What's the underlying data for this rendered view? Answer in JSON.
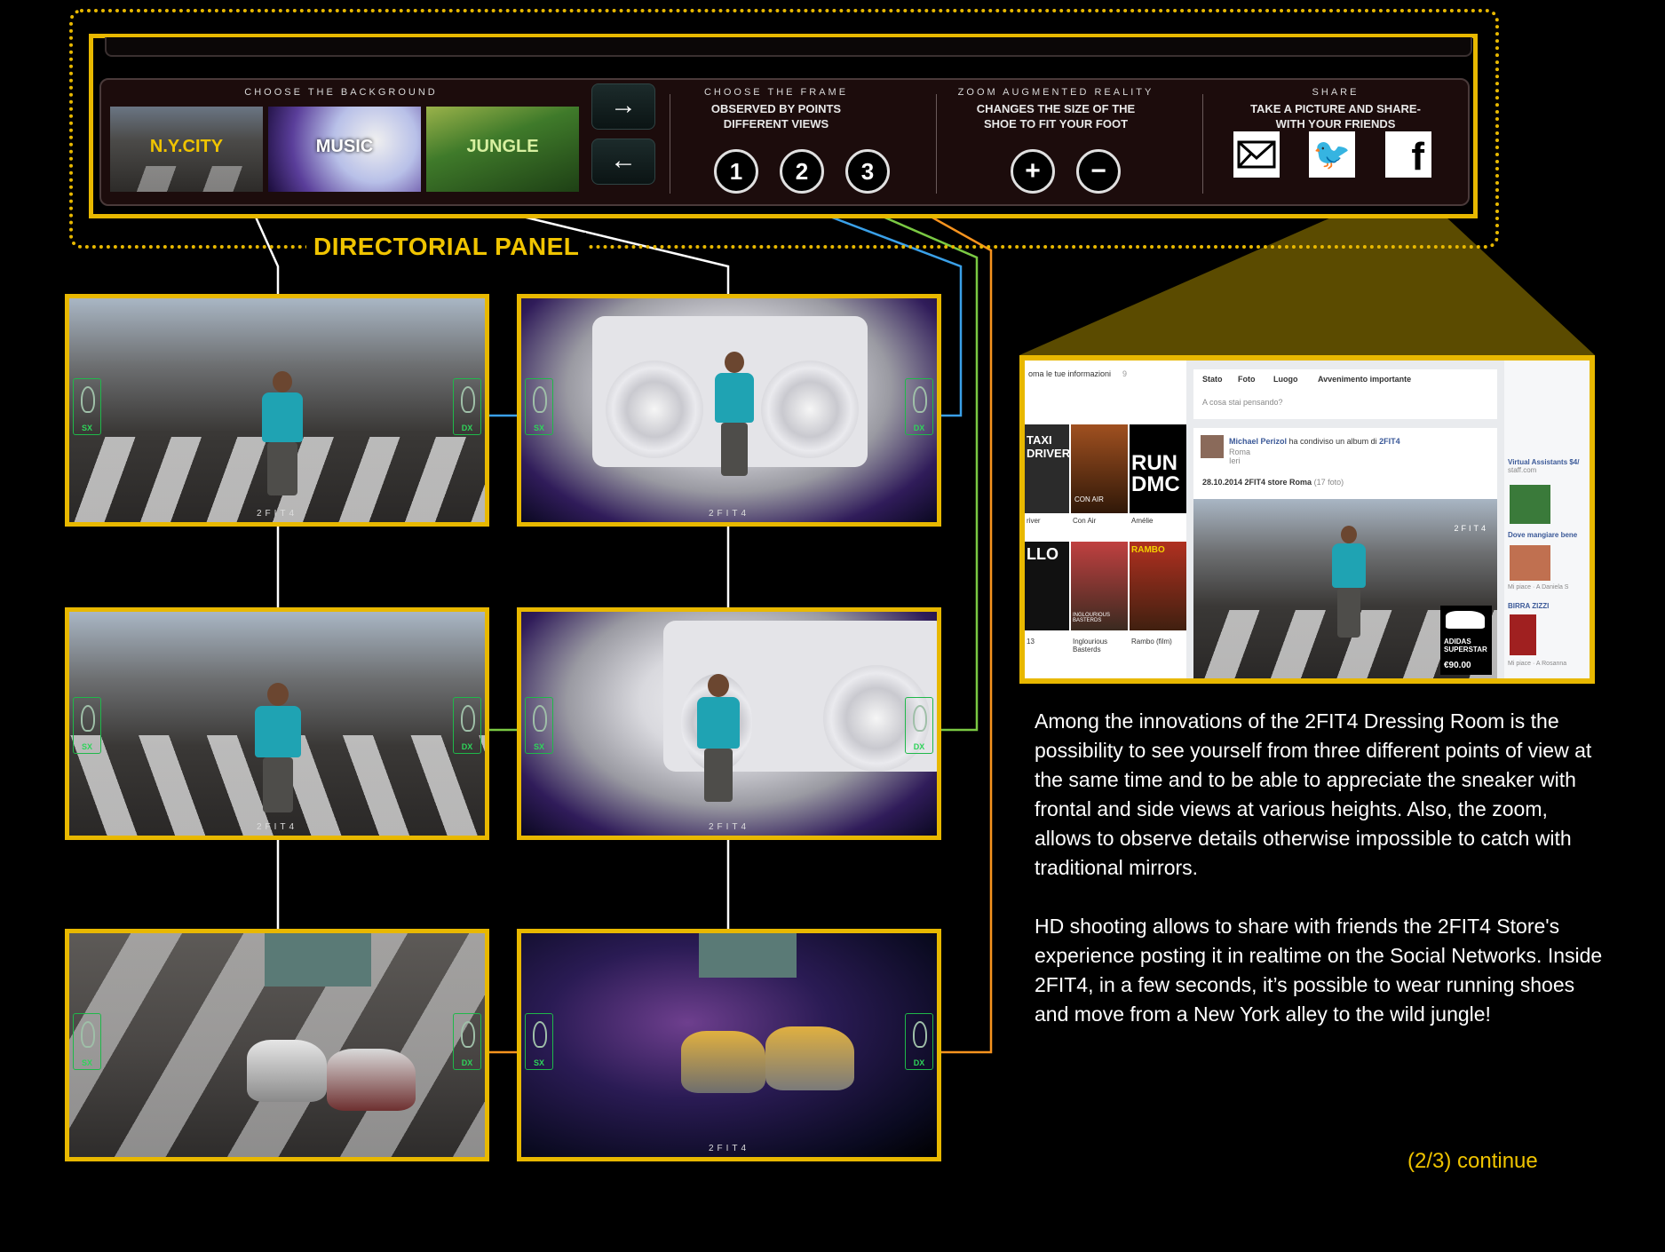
{
  "panel": {
    "label": "DIRECTORIAL PANEL",
    "background": {
      "heading": "CHOOSE THE BACKGROUND",
      "options": [
        "N.Y.CITY",
        "MUSIC",
        "JUNGLE"
      ],
      "next_icon": "→",
      "prev_icon": "←"
    },
    "frame": {
      "heading": "CHOOSE THE FRAME",
      "title": "OBSERVED BY POINTS DIFFERENT VIEWS",
      "buttons": [
        "1",
        "2",
        "3"
      ]
    },
    "zoom": {
      "heading": "ZOOM AUGMENTED REALITY",
      "title": "CHANGES THE SIZE OF THE SHOE TO FIT YOUR FOOT",
      "plus": "+",
      "minus": "−"
    },
    "share": {
      "heading": "SHARE",
      "title": "TAKE A PICTURE AND SHARE- WITH YOUR FRIENDS",
      "icons": [
        "mail-icon",
        "twitter-icon",
        "facebook-icon"
      ],
      "twitter_glyph": "🐦",
      "facebook_glyph": "f"
    }
  },
  "frames": {
    "watermark": "2FIT4",
    "left_marker": "SX",
    "right_marker": "DX"
  },
  "facebook": {
    "left_header": "oma le tue informazioni",
    "left_count": "9",
    "tabs": [
      "Stato",
      "Foto",
      "Luogo",
      "Avvenimento importante"
    ],
    "status_placeholder": "A cosa stai pensando?",
    "post_author": "Michael Perizol",
    "post_action": "ha condiviso un album di",
    "post_target": "2FIT4",
    "post_location": "Roma",
    "post_time": "Ieri",
    "album_title": "28.10.2014 2FIT4 store Roma",
    "album_count": "(17 foto)",
    "photo_logo": "2FIT4",
    "product_name": "ADIDAS SUPERSTAR",
    "product_price": "€90.00",
    "movies": [
      {
        "title": "TAXI DRIVER",
        "caption": "river"
      },
      {
        "title": "CON AIR",
        "caption": "Con Air"
      },
      {
        "title": "RUN DMC",
        "caption": "Amélie"
      },
      {
        "title": "LLO",
        "caption": "13"
      },
      {
        "title": "INGLOURIOUS BASTERDS",
        "caption": "Inglourious Basterds"
      },
      {
        "title": "RAMBO",
        "caption": "Rambo (film)"
      }
    ],
    "ads": [
      {
        "title": "Virtual Assistants $4/",
        "sub": "staff.com"
      },
      {
        "title": "Dove mangiare bene",
        "sub": "Mi piace · A Daniela S"
      },
      {
        "title": "BIRRA ZIZZI",
        "sub": "Mi piace · A Rosanna"
      }
    ]
  },
  "description": {
    "p1": "Among the innovations of the 2FIT4 Dressing Room is the possibility to see yourself from three different points of view at the same time and to be able to appreciate the sneaker with frontal and side views at various heights. Also, the zoom, allows to observe details otherwise impossible to catch with traditional mirrors.",
    "p2": "HD shooting allows to share with friends the 2FIT4 Store's experience posting it in realtime on the Social Networks. Inside 2FIT4, in a few seconds, it’s possible to wear running shoes and move from a New York alley to the wild jungle!"
  },
  "footer": {
    "continue": "(2/3) continue"
  },
  "colors": {
    "accent_gold": "#e8b800",
    "line_blue": "#3aa0e8",
    "line_green": "#7ac943",
    "line_orange": "#f7931e",
    "line_white": "#ffffff"
  }
}
